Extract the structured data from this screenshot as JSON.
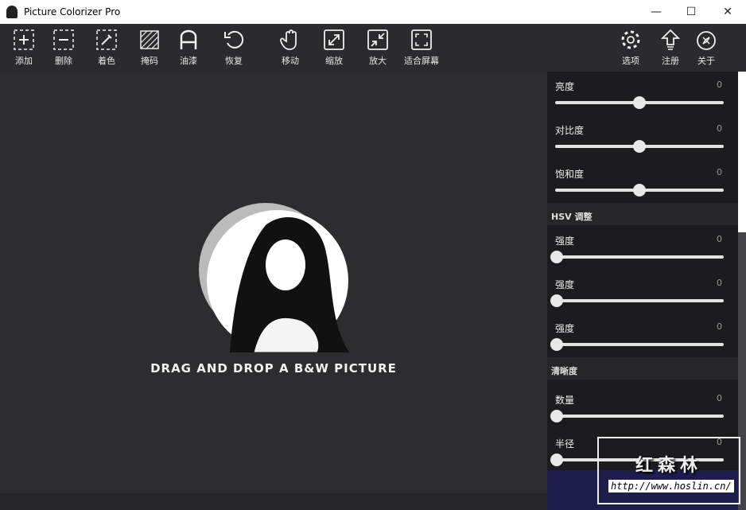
{
  "app": {
    "title": "Picture Colorizer Pro"
  },
  "toolbar": {
    "left": [
      {
        "id": "add",
        "label": "添加",
        "icon": "add-icon"
      },
      {
        "id": "delete",
        "label": "删除",
        "icon": "remove-icon"
      },
      {
        "id": "colorize",
        "label": "着色",
        "icon": "eyedropper-icon"
      },
      {
        "id": "mask",
        "label": "掩码",
        "icon": "mask-icon"
      },
      {
        "id": "paint",
        "label": "油漆",
        "icon": "paint-icon"
      },
      {
        "id": "restore",
        "label": "恢复",
        "icon": "undo-icon"
      },
      {
        "id": "move",
        "label": "移动",
        "icon": "hand-icon"
      },
      {
        "id": "zoom",
        "label": "缩放",
        "icon": "expand-icon"
      },
      {
        "id": "enlarge",
        "label": "放大",
        "icon": "shrink-icon"
      },
      {
        "id": "fit",
        "label": "适合屏幕",
        "icon": "fit-screen-icon"
      }
    ],
    "right": [
      {
        "id": "options",
        "label": "选项",
        "icon": "gear-icon"
      },
      {
        "id": "register",
        "label": "注册",
        "icon": "upload-icon"
      },
      {
        "id": "about",
        "label": "关于",
        "icon": "compass-icon"
      }
    ]
  },
  "canvas": {
    "drop_text": "DRAG AND DROP A B&W PICTURE"
  },
  "panel": {
    "basic": [
      {
        "label": "亮度",
        "value": 0,
        "fraction": 0.5
      },
      {
        "label": "对比度",
        "value": 0,
        "fraction": 0.5
      },
      {
        "label": "饱和度",
        "value": 0,
        "fraction": 0.5
      }
    ],
    "hsv_title": "HSV 调整",
    "hsv": [
      {
        "label": "强度",
        "value": 0,
        "fraction": 0
      },
      {
        "label": "强度",
        "value": 0,
        "fraction": 0
      },
      {
        "label": "强度",
        "value": 0,
        "fraction": 0
      }
    ],
    "sharp_title": "清晰度",
    "sharp": [
      {
        "label": "数量",
        "value": 0,
        "fraction": 0
      },
      {
        "label": "半径",
        "value": 0,
        "fraction": 0
      }
    ]
  },
  "watermark": {
    "text": "红森林",
    "url": "http://www.hoslin.cn/"
  }
}
